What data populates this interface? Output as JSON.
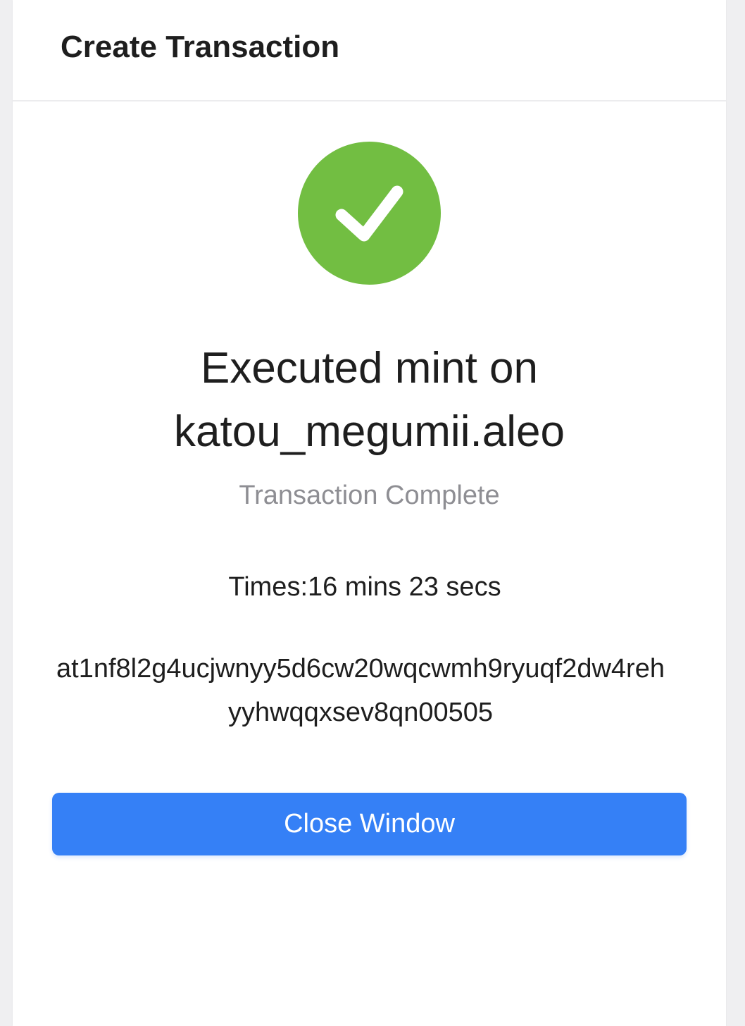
{
  "header": {
    "title": "Create Transaction"
  },
  "status": {
    "icon": "checkmark-circle-icon",
    "color": "#72be42"
  },
  "main": {
    "headline_line1": "Executed mint on",
    "headline_line2": "katou_megumii.aleo",
    "subtitle": "Transaction Complete",
    "elapsed_time": "Times:16 mins 23 secs",
    "transaction_id": "at1nf8l2g4ucjwnyy5d6cw20wqcwmh9ryuqf2dw4rehyyhwqqxsev8qn00505"
  },
  "actions": {
    "close_label": "Close Window",
    "close_color": "#3580f6"
  }
}
